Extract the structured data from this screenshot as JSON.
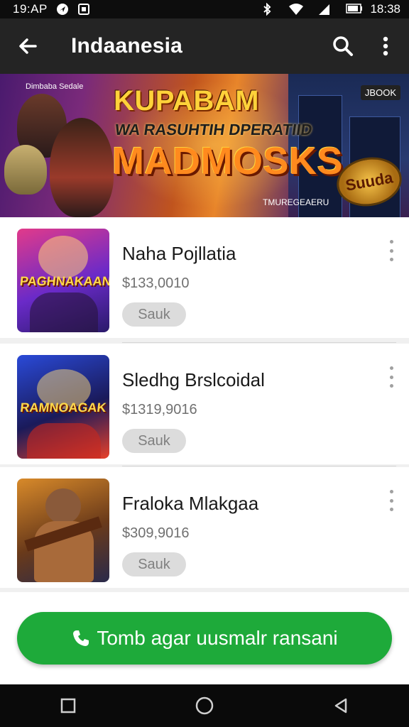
{
  "status_bar": {
    "time_left": "19:AP",
    "time_right": "18:38",
    "icons": [
      "location-icon",
      "notification-icon",
      "bluetooth-icon",
      "wifi-icon",
      "signal-icon",
      "battery-icon"
    ]
  },
  "app_bar": {
    "title": "Indaanesia",
    "icons": [
      "back-arrow-icon",
      "search-icon",
      "more-vert-icon"
    ]
  },
  "banner": {
    "top_caption": "Dimbaba Sedale",
    "headline_line1": "KUPABAM",
    "headline_line2": "WA RASUHTIH DPERATIID",
    "headline_line3": "MADMOSKS",
    "tag": "JBOOK",
    "bottom_caption": "TMUREGEAERU",
    "badge_text": "Suuda"
  },
  "products": [
    {
      "thumb_label": "PAGHNAKAAN",
      "name": "Naha Pojllatia",
      "price": "$133,0010",
      "button_label": "Sauk",
      "thumb_colors": [
        "#e23a8a",
        "#6a2ac8",
        "#2a1a6a"
      ]
    },
    {
      "thumb_label": "RAMNOAGAK",
      "name": "Sledhg Brslcoidal",
      "price": "$1319,9016",
      "button_label": "Sauk",
      "thumb_colors": [
        "#2a4ad8",
        "#1a1a5a",
        "#e8402a"
      ]
    },
    {
      "thumb_label": "",
      "name": "Fraloka Mlakgaa",
      "price": "$309,9016",
      "button_label": "Sauk",
      "thumb_colors": [
        "#d88a2a",
        "#6a3a1a",
        "#2a2a4a"
      ]
    }
  ],
  "cta": {
    "label": "Tomb agar uusmalr ransani",
    "icon": "phone-icon",
    "color": "#1eaa3a"
  },
  "nav_bar": {
    "icons": [
      "recents-square-icon",
      "home-circle-icon",
      "back-triangle-icon"
    ]
  }
}
